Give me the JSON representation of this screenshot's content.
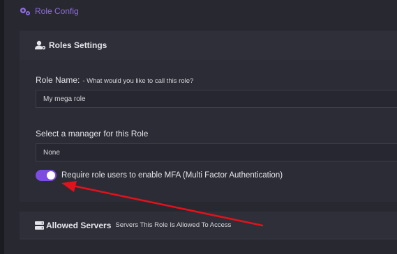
{
  "breadcrumb": {
    "title": "Role Config",
    "icon": "gears-icon"
  },
  "roles_card": {
    "title": "Roles Settings",
    "icon": "user-cog-icon",
    "role_name": {
      "label": "Role Name:",
      "hint": "- What would you like to call this role?",
      "value": "My mega role"
    },
    "manager": {
      "label": "Select a manager for this Role",
      "value": "None"
    },
    "mfa": {
      "label": "Require role users to enable MFA (Multi Factor Authentication)",
      "enabled": true
    }
  },
  "servers_card": {
    "title": "Allowed Servers",
    "subtitle": "Servers This Role Is Allowed To Access",
    "icon": "server-icon"
  },
  "colors": {
    "accent": "#7d4ce0",
    "arrow": "#e0121c",
    "background": "#272830"
  }
}
